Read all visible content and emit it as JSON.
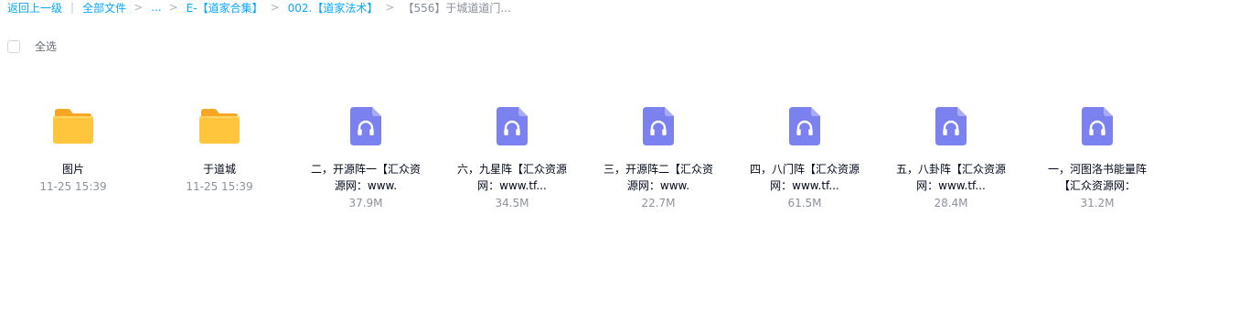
{
  "breadcrumb": {
    "back": "返回上一级",
    "divider": "|",
    "items": [
      "全部文件",
      "...",
      "E-【道家合集】",
      "002.【道家法术】"
    ],
    "current": "【556】于城道道门...",
    "separator": ">"
  },
  "toolbar": {
    "select_all_label": "全选"
  },
  "files": [
    {
      "type": "folder",
      "name": "图片",
      "meta": "11-25 15:39",
      "icon": "folder-icon"
    },
    {
      "type": "folder",
      "name": "于道城",
      "meta": "11-25 15:39",
      "icon": "folder-icon"
    },
    {
      "type": "audio",
      "name": "二，开源阵一【汇众资源网：www.",
      "meta": "37.9M",
      "icon": "audio-file-icon"
    },
    {
      "type": "audio",
      "name": "六，九星阵【汇众资源网：www.tf...",
      "meta": "34.5M",
      "icon": "audio-file-icon"
    },
    {
      "type": "audio",
      "name": "三，开源阵二【汇众资源网：www.",
      "meta": "22.7M",
      "icon": "audio-file-icon"
    },
    {
      "type": "audio",
      "name": "四，八门阵【汇众资源网：www.tf...",
      "meta": "61.5M",
      "icon": "audio-file-icon"
    },
    {
      "type": "audio",
      "name": "五，八卦阵【汇众资源网：www.tf...",
      "meta": "28.4M",
      "icon": "audio-file-icon"
    },
    {
      "type": "audio",
      "name": "一，河图洛书能量阵【汇众资源网：",
      "meta": "31.2M",
      "icon": "audio-file-icon"
    }
  ],
  "colors": {
    "link": "#06a7ff",
    "folder": "#ffc53d",
    "audio": "#7b82f0"
  }
}
